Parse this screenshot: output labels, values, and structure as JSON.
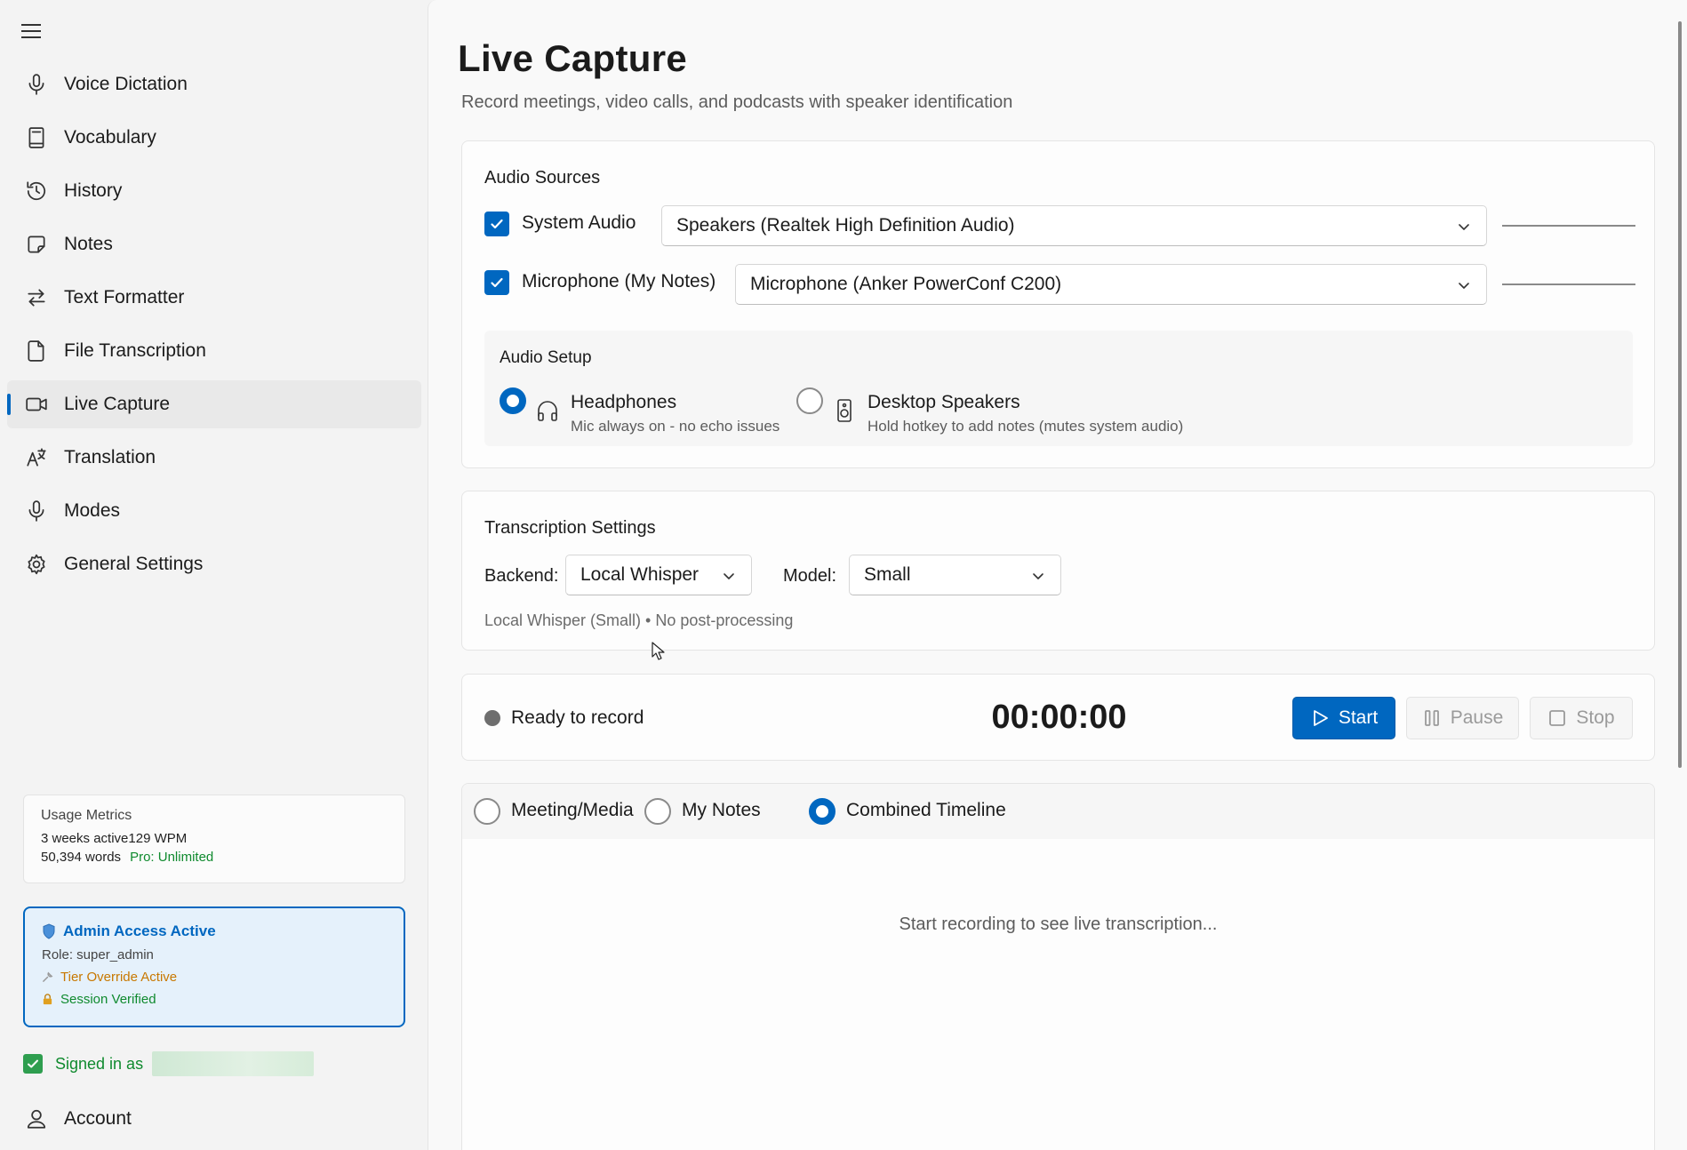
{
  "sidebar": {
    "menu_icon": "hamburger-menu-icon",
    "items": [
      {
        "label": "Voice Dictation",
        "icon": "microphone-icon",
        "active": false
      },
      {
        "label": "Vocabulary",
        "icon": "book-icon",
        "active": false
      },
      {
        "label": "History",
        "icon": "history-icon",
        "active": false
      },
      {
        "label": "Notes",
        "icon": "note-icon",
        "active": false
      },
      {
        "label": "Text Formatter",
        "icon": "swap-arrows-icon",
        "active": false
      },
      {
        "label": "File Transcription",
        "icon": "document-icon",
        "active": false
      },
      {
        "label": "Live Capture",
        "icon": "video-camera-icon",
        "active": true
      },
      {
        "label": "Translation",
        "icon": "translate-icon",
        "active": false
      },
      {
        "label": "Modes",
        "icon": "microphone-icon",
        "active": false
      },
      {
        "label": "General Settings",
        "icon": "gear-icon",
        "active": false
      }
    ],
    "usage": {
      "title": "Usage Metrics",
      "active": "3 weeks active",
      "wpm": "129 WPM",
      "words": "50,394 words",
      "plan": "Pro: Unlimited"
    },
    "admin": {
      "title": "Admin Access Active",
      "role": "Role: super_admin",
      "override": "Tier Override Active",
      "session": "Session Verified"
    },
    "signed_in": "Signed in as",
    "account": "Account"
  },
  "main": {
    "title": "Live Capture",
    "subtitle": "Record meetings, video calls, and podcasts with speaker identification",
    "audio_sources": {
      "title": "Audio Sources",
      "system_audio": {
        "label": "System Audio",
        "checked": true,
        "device": "Speakers (Realtek High Definition Audio)"
      },
      "microphone": {
        "label": "Microphone (My Notes)",
        "checked": true,
        "device": "Microphone (Anker PowerConf C200)"
      },
      "setup": {
        "title": "Audio Setup",
        "headphones": {
          "title": "Headphones",
          "desc": "Mic always on - no echo issues",
          "selected": true
        },
        "speakers": {
          "title": "Desktop Speakers",
          "desc": "Hold hotkey to add notes (mutes system audio)",
          "selected": false
        }
      }
    },
    "transcription": {
      "title": "Transcription Settings",
      "backend_label": "Backend:",
      "backend_value": "Local Whisper",
      "model_label": "Model:",
      "model_value": "Small",
      "info": "Local Whisper (Small) • No post-processing"
    },
    "recorder": {
      "status": "Ready to record",
      "timer": "00:00:00",
      "start": "Start",
      "pause": "Pause",
      "stop": "Stop"
    },
    "view_tabs": {
      "meeting": "Meeting/Media",
      "notes": "My Notes",
      "combined": "Combined Timeline",
      "selected": "Combined Timeline"
    },
    "placeholder": "Start recording to see live transcription..."
  },
  "colors": {
    "accent": "#0067c0",
    "success": "#0f8a2e",
    "warning": "#c87800"
  }
}
